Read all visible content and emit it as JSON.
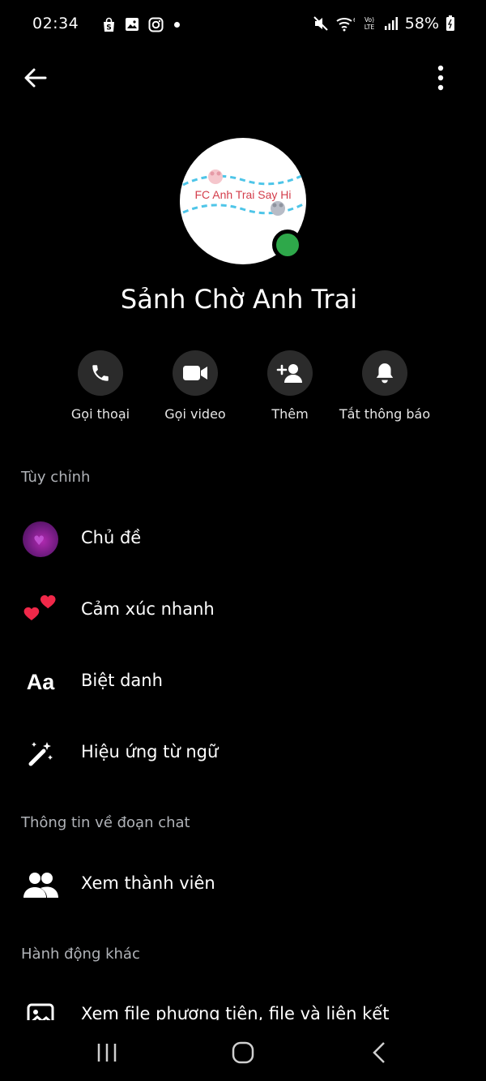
{
  "status_bar": {
    "time": "02:34",
    "battery": "58%",
    "left_icons": [
      "shopee-bag-icon",
      "gallery-icon",
      "instagram-icon",
      "dot-icon"
    ],
    "right_icons": [
      "mute-icon",
      "wifi-icon",
      "volte-icon",
      "signal-icon",
      "battery-icon"
    ]
  },
  "nav": {
    "back_icon": "arrow-left-icon",
    "more_icon": "more-vertical-icon"
  },
  "profile": {
    "avatar_text": "FC Anh Trai Say Hi",
    "name": "Sảnh Chờ Anh Trai",
    "online_color": "#2ea84a"
  },
  "actions": [
    {
      "label": "Gọi thoại",
      "icon": "phone-icon"
    },
    {
      "label": "Gọi video",
      "icon": "video-camera-icon"
    },
    {
      "label": "Thêm",
      "icon": "add-person-icon"
    },
    {
      "label": "Tắt thông báo",
      "icon": "bell-icon"
    }
  ],
  "sections": {
    "customize": {
      "title": "Tùy chỉnh",
      "items": [
        {
          "label": "Chủ đề",
          "icon": "theme-swatch-icon"
        },
        {
          "label": "Cảm xúc nhanh",
          "icon": "heart-emoji-icon"
        },
        {
          "label": "Biệt danh",
          "icon": "aa-text-icon",
          "icon_text": "Aa"
        },
        {
          "label": "Hiệu ứng từ ngữ",
          "icon": "magic-wand-icon"
        }
      ]
    },
    "chat_info": {
      "title": "Thông tin về đoạn chat",
      "items": [
        {
          "label": "Xem thành viên",
          "icon": "people-icon"
        }
      ]
    },
    "other_actions": {
      "title": "Hành động khác",
      "items": [
        {
          "label": "Xem file phương tiện, file và liên kết",
          "icon": "image-icon"
        }
      ]
    }
  },
  "system_nav": {
    "recents_icon": "recents-icon",
    "home_icon": "home-icon",
    "back_icon": "chevron-left-icon"
  },
  "colors": {
    "background": "#000000",
    "button_circle": "#2b2b2b",
    "secondary_text": "#b0b3b8",
    "heart_red": "#f02849"
  }
}
